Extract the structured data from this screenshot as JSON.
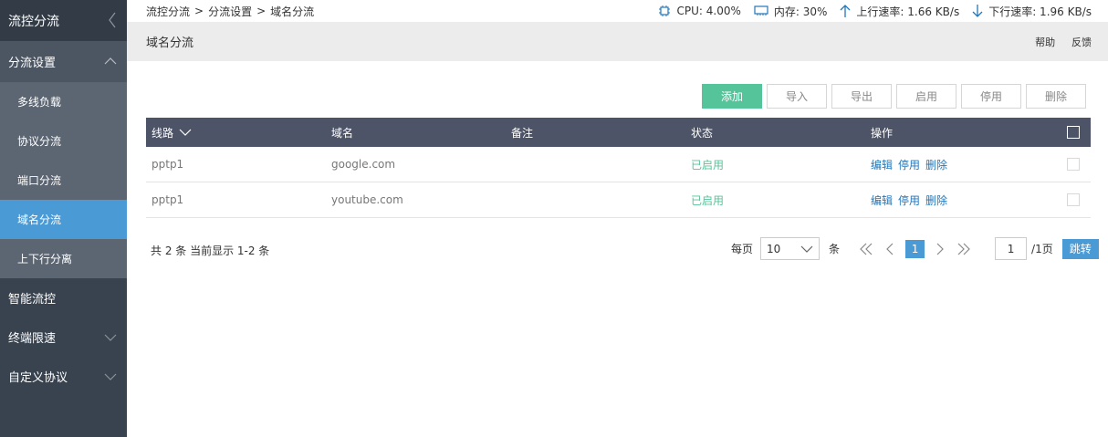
{
  "sidebar": {
    "app_title": "流控分流",
    "group_open": {
      "label": "分流设置"
    },
    "subitems": [
      {
        "label": "多线负载"
      },
      {
        "label": "协议分流"
      },
      {
        "label": "端口分流"
      },
      {
        "label": "域名分流"
      },
      {
        "label": "上下行分离"
      }
    ],
    "items": [
      {
        "label": "智能流控"
      },
      {
        "label": "终端限速"
      },
      {
        "label": "自定义协议"
      }
    ]
  },
  "breadcrumb": {
    "items": [
      "流控分流",
      "分流设置",
      "域名分流"
    ],
    "separator": ">"
  },
  "stats": {
    "cpu": "CPU: 4.00%",
    "mem": "内存: 30%",
    "up": "上行速率: 1.66 KB/s",
    "down": "下行速率: 1.96 KB/s"
  },
  "page": {
    "title": "域名分流",
    "help": "帮助",
    "feedback": "反馈"
  },
  "toolbar": {
    "add": "添加",
    "import": "导入",
    "export": "导出",
    "enable": "启用",
    "disable": "停用",
    "delete": "删除"
  },
  "table": {
    "headers": {
      "line": "线路",
      "domain": "域名",
      "remark": "备注",
      "status": "状态",
      "ops": "操作"
    },
    "rows": [
      {
        "line": "pptp1",
        "domain": "google.com",
        "remark": "",
        "status": "已启用",
        "edit": "编辑",
        "disable": "停用",
        "delete": "删除"
      },
      {
        "line": "pptp1",
        "domain": "youtube.com",
        "remark": "",
        "status": "已启用",
        "edit": "编辑",
        "disable": "停用",
        "delete": "删除"
      }
    ]
  },
  "pagination": {
    "summary": "共 2 条 当前显示 1-2 条",
    "per_page_label": "每页",
    "per_page_value": "10",
    "unit": "条",
    "current_page": "1",
    "goto_value": "1",
    "total_pages": "/1页",
    "jump": "跳转"
  },
  "colors": {
    "accent": "#4a9ad6",
    "success": "#55c49a",
    "header": "#4d5467",
    "sidebar": "#39434f"
  }
}
